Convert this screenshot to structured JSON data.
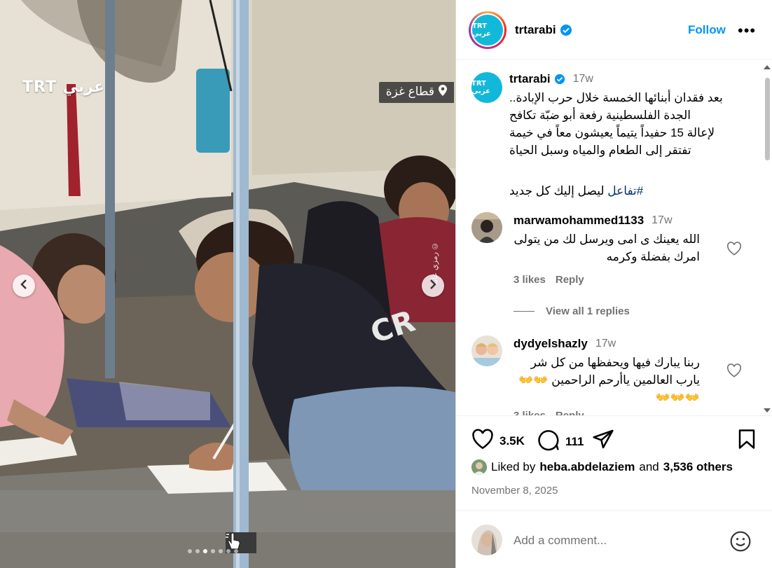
{
  "media": {
    "brand_logo": "TRT عربي",
    "location": "قطاع غزة",
    "photo_credit": "رمزي عابد ©",
    "slide_count": 7,
    "active_slide": 2
  },
  "header": {
    "username": "trtarabi",
    "follow_label": "Follow",
    "avatar_text": "TRT عربي"
  },
  "caption": {
    "username": "trtarabi",
    "time": "17w",
    "lines": [
      "بعد فقدان أبنائها الخمسة خلال حرب الإبادة..",
      "الجدة الفلسطينية رفعة أبو ضبّة تكافح",
      "لإعالة 15 حفيداً يتيماً يعيشون معاً في خيمة",
      "تفتقر إلى الطعام والمياه وسبل الحياة"
    ],
    "hashtag": "#تفاعل",
    "cta_text": "ليصل إليك كل جديد"
  },
  "comments": [
    {
      "username": "marwamohammed1133",
      "time": "17w",
      "text": "الله يعينك ى امى ويرسل لك من يتولى امرك بفضلة وكرمه",
      "likes": "3 likes",
      "reply_label": "Reply",
      "view_replies": "View all 1 replies"
    },
    {
      "username": "dydyelshazly",
      "time": "17w",
      "text": "ربنا يبارك فيها ويحفظها من كل شر يارب العالمين ياأرحم الراحمين 👐👐 👐👐👐",
      "likes": "3 likes",
      "reply_label": "Reply"
    }
  ],
  "actions": {
    "likes_count": "3.5K",
    "comments_count": "111"
  },
  "liked_by": {
    "prefix": "Liked by",
    "user": "heba.abdelaziem",
    "and": "and",
    "others": "3,536 others"
  },
  "post_date": "November 8, 2025",
  "add_comment": {
    "placeholder": "Add a comment..."
  },
  "colors": {
    "accent_blue": "#0095f6",
    "verified_blue": "#0095f6",
    "trt_cyan": "#12b8d9",
    "muted_text": "#737373"
  }
}
